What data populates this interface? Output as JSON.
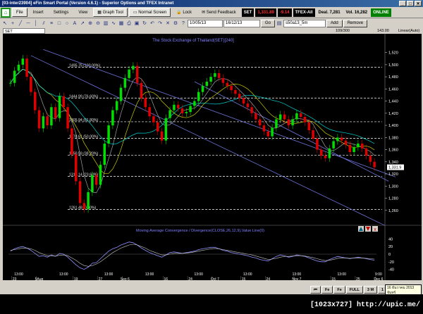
{
  "window": {
    "title": "[03-inter23904] eFin Smart Portal (Version 4.6.1) - Superior Options and TFEX Intranet",
    "min": "_",
    "max": "□",
    "close": "✕"
  },
  "menu": {
    "items": [
      {
        "label": "File"
      },
      {
        "label": "Insert"
      },
      {
        "label": "Settings"
      },
      {
        "label": "View"
      }
    ],
    "graph_tool": "Graph Tool",
    "normal_screen": "Normal Screen",
    "lock": "Lock",
    "send_feedback": "Send Feedback",
    "quote": {
      "symbol": "SET",
      "price": "1,331.89",
      "change": "-9.14",
      "market": "TFEX-All",
      "deal": "Deal. 7,281",
      "vol": "Vol. 16,282"
    },
    "online": "ONLINE"
  },
  "toolbar": {
    "from_date": "10/05/13",
    "to_date": "16/12/13",
    "go": "Go",
    "series": "s50a13_5m",
    "add": "Add",
    "remove": "Remove"
  },
  "strip": {
    "symbol": "SET",
    "count": "109/300",
    "value": "143.00",
    "scale": "Linear(Auto)"
  },
  "chart_data": {
    "type": "candlestick",
    "title": "The Stock Exchange of Thailand(SET)[240]",
    "y_ticks": [
      1520,
      1500,
      1480,
      1460,
      1440,
      1420,
      1400,
      1380,
      1360,
      1340,
      1320,
      1300,
      1280,
      1260
    ],
    "y_tick_labels": [
      "1,520",
      "1,500",
      "1,480",
      "1,460",
      "1,440",
      "1,420",
      "1,400",
      "1,380",
      "1,360",
      "1,340",
      "1,320",
      "1,300",
      "1,280",
      "1,260"
    ],
    "ylim": [
      1240,
      1530
    ],
    "last_price": "1,331.9",
    "fib_levels": [
      {
        "label": "1495.75 (100.00%)",
        "value": 1495.75
      },
      {
        "label": "1444.99 (76.60%)",
        "value": 1444.99
      },
      {
        "label": "1405.94 (61.80%)",
        "value": 1405.94
      },
      {
        "label": "1378.61 (50.00%)",
        "value": 1378.61
      },
      {
        "label": "1350.59 (38.20%)",
        "value": 1350.59
      },
      {
        "label": "1316.14 (23.60%)",
        "value": 1316.14
      },
      {
        "label": "1261.48 (0.00%)",
        "value": 1261.48
      }
    ],
    "close": [
      1470,
      1490,
      1500,
      1510,
      1480,
      1455,
      1425,
      1395,
      1415,
      1400,
      1430,
      1412,
      1448,
      1430,
      1395,
      1352,
      1308,
      1272,
      1262,
      1290,
      1318,
      1302,
      1335,
      1370,
      1400,
      1425,
      1440,
      1462,
      1478,
      1492,
      1498,
      1470,
      1445,
      1430,
      1415,
      1405,
      1390,
      1375,
      1412,
      1425,
      1434,
      1428,
      1420,
      1422,
      1432,
      1440,
      1455,
      1465,
      1472,
      1480,
      1486,
      1478,
      1470,
      1465,
      1458,
      1452,
      1445,
      1436,
      1430,
      1420,
      1410,
      1400,
      1390,
      1382,
      1396,
      1410,
      1418,
      1410,
      1400,
      1410,
      1420,
      1414,
      1405,
      1392,
      1378,
      1360,
      1350,
      1346,
      1362,
      1374,
      1380,
      1375,
      1368,
      1356,
      1364,
      1370,
      1362,
      1350,
      1340,
      1331
    ],
    "x_labels": [
      {
        "label": "13:00",
        "row": 1,
        "i": 2
      },
      {
        "label": "13:00",
        "row": 1,
        "i": 13
      },
      {
        "label": "13:00",
        "row": 1,
        "i": 24
      },
      {
        "label": "13:00",
        "row": 1,
        "i": 34
      },
      {
        "label": "13:00",
        "row": 1,
        "i": 46
      },
      {
        "label": "13:00",
        "row": 1,
        "i": 58
      },
      {
        "label": "13:00",
        "row": 1,
        "i": 70
      },
      {
        "label": "13:00",
        "row": 1,
        "i": 81
      },
      {
        "label": "9:00",
        "row": 1,
        "i": 90
      },
      {
        "label": "23",
        "row": 2,
        "i": 1
      },
      {
        "label": "5Aug",
        "row": 2,
        "i": 7
      },
      {
        "label": "19",
        "row": 2,
        "i": 16
      },
      {
        "label": "27",
        "row": 2,
        "i": 22
      },
      {
        "label": "Sep 6",
        "row": 2,
        "i": 28
      },
      {
        "label": "16",
        "row": 2,
        "i": 38
      },
      {
        "label": "24",
        "row": 2,
        "i": 44
      },
      {
        "label": "Oct 7",
        "row": 2,
        "i": 50
      },
      {
        "label": "15",
        "row": 2,
        "i": 57
      },
      {
        "label": "24",
        "row": 2,
        "i": 63
      },
      {
        "label": "Nov 7",
        "row": 2,
        "i": 70
      },
      {
        "label": "15",
        "row": 2,
        "i": 79
      },
      {
        "label": "25",
        "row": 2,
        "i": 85
      },
      {
        "label": "Dec 6",
        "row": 2,
        "i": 90
      }
    ],
    "macd": {
      "title": "Moving Average Convergence / Divergence(CLOSE,26,12,9),Value Line(0)",
      "y_ticks": [
        40,
        20,
        0,
        -20,
        -40
      ],
      "ylim": [
        -50,
        50
      ],
      "values": [
        8,
        14,
        18,
        20,
        16,
        10,
        2,
        -6,
        -4,
        -8,
        -2,
        -6,
        2,
        0,
        -8,
        -18,
        -28,
        -36,
        -40,
        -34,
        -24,
        -22,
        -12,
        -2,
        8,
        14,
        18,
        24,
        28,
        32,
        30,
        24,
        16,
        10,
        4,
        0,
        -4,
        -8,
        -2,
        4,
        6,
        4,
        2,
        4,
        6,
        8,
        12,
        14,
        16,
        18,
        18,
        14,
        10,
        8,
        4,
        2,
        0,
        -2,
        -4,
        -8,
        -10,
        -14,
        -16,
        -18,
        -12,
        -6,
        -2,
        -4,
        -8,
        -6,
        -2,
        -4,
        -6,
        -10,
        -14,
        -18,
        -20,
        -20,
        -14,
        -10,
        -6,
        -8,
        -10,
        -12,
        -10,
        -8,
        -10,
        -12,
        -14,
        -16
      ],
      "signal": [
        10,
        12,
        14,
        16,
        16,
        14,
        10,
        4,
        0,
        -4,
        -4,
        -5,
        -3,
        -2,
        -4,
        -10,
        -16,
        -24,
        -30,
        -32,
        -30,
        -26,
        -20,
        -12,
        -4,
        4,
        10,
        16,
        20,
        24,
        26,
        24,
        20,
        16,
        10,
        6,
        2,
        -2,
        -2,
        0,
        2,
        2,
        2,
        3,
        4,
        6,
        8,
        10,
        12,
        14,
        15,
        14,
        12,
        10,
        8,
        6,
        4,
        2,
        0,
        -2,
        -5,
        -8,
        -11,
        -14,
        -13,
        -11,
        -8,
        -6,
        -6,
        -5,
        -4,
        -4,
        -5,
        -7,
        -9,
        -12,
        -15,
        -17,
        -16,
        -14,
        -11,
        -10,
        -10,
        -11,
        -10,
        -10,
        -10,
        -11,
        -12,
        -13
      ]
    }
  },
  "nav": {
    "prev": "⏮",
    "fast_back": "Fe",
    "back": "Fe",
    "tabs": [
      "FULL",
      "3 M",
      "1 M"
    ],
    "tooltip_date": "16 ธันวาคม 2013",
    "tooltip_day": "จันทร์"
  },
  "watermark": "[1023x727] http://upic.me/",
  "colors": {
    "up": "#00e000",
    "down": "#e00000",
    "fib": "#ffffff",
    "channel": "#6d72d8",
    "ma1": "#c8c8c8",
    "ma2": "#ffff00",
    "ma3": "#00ffff",
    "macd": "#9090ff",
    "signal": "#c8c8c8"
  }
}
